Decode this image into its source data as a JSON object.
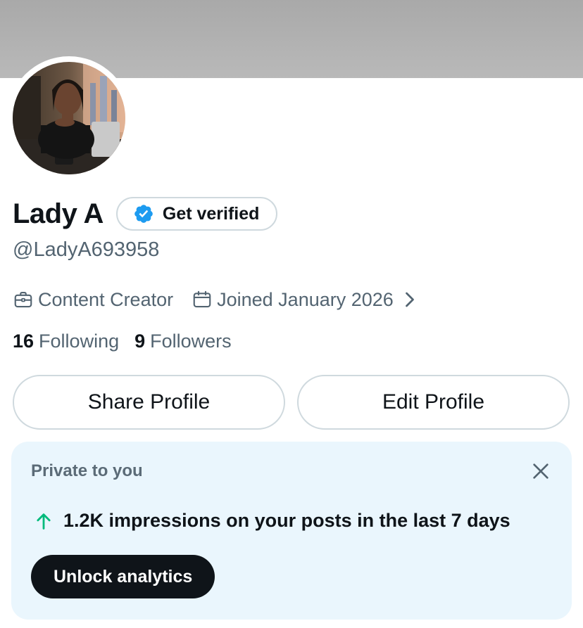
{
  "profile": {
    "display_name": "Lady A",
    "handle": "@LadyA693958",
    "verify_label": "Get verified",
    "profession": "Content Creator",
    "joined": "Joined January 2026",
    "following_count": "16",
    "following_label": "Following",
    "followers_count": "9",
    "followers_label": "Followers"
  },
  "actions": {
    "share_label": "Share Profile",
    "edit_label": "Edit Profile"
  },
  "private_card": {
    "title": "Private to you",
    "impressions_text": "1.2K impressions on your posts in the last 7 days",
    "unlock_label": "Unlock analytics"
  },
  "colors": {
    "verified_blue": "#1d9bf0",
    "growth_green": "#00ba7c",
    "card_bg": "#eaf6fd"
  },
  "icons": {
    "verify": "verified-badge-icon",
    "profession": "briefcase-icon",
    "joined": "calendar-icon",
    "chevron": "chevron-right-icon",
    "close": "close-icon",
    "growth": "arrow-up-icon"
  }
}
